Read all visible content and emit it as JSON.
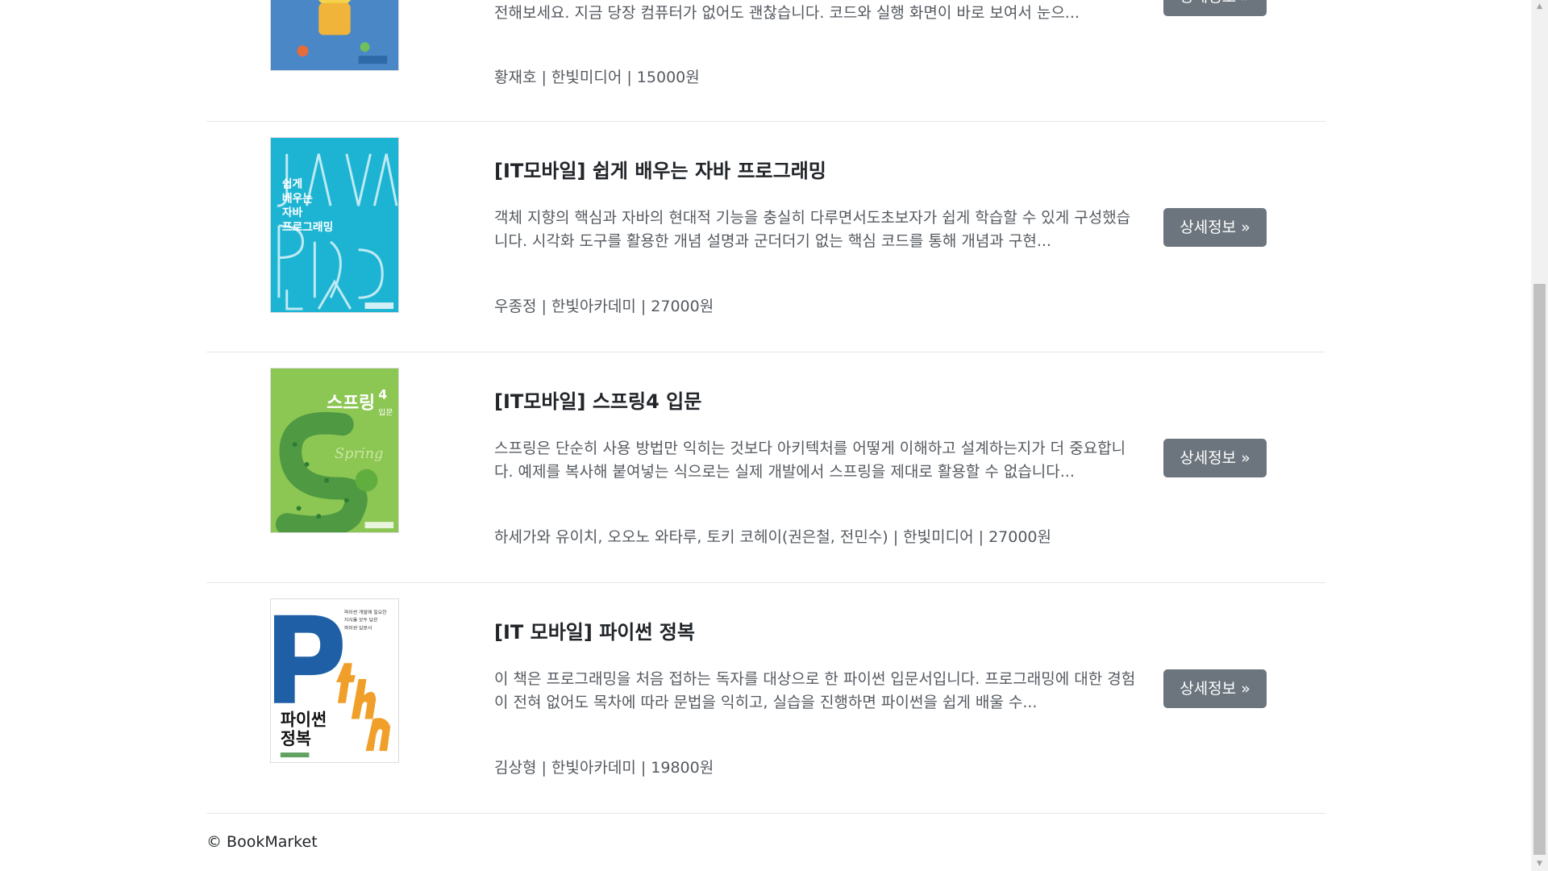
{
  "books": [
    {
      "title": "",
      "description": "전해보세요. 지금 당장 컴퓨터가 없어도 괜찮습니다. 코드와 실행 화면이 바로 보여서 눈으...",
      "meta": "황재호 | 한빛미디어 | 15000원",
      "button_label": "상세정보 »"
    },
    {
      "title": "[IT모바일] 쉽게 배우는 자바 프로그래밍",
      "description": "객체 지향의 핵심과 자바의 현대적 기능을 충실히 다루면서도초보자가 쉽게 학습할 수 있게 구성했습니다. 시각화 도구를 활용한 개념 설명과 군더더기 없는 핵심 코드를 통해 개념과 구현...",
      "meta": "우종정 | 한빛아카데미 | 27000원",
      "button_label": "상세정보 »",
      "cover_text": "쉽게 배우는 자바 프로그래밍"
    },
    {
      "title": "[IT모바일] 스프링4 입문",
      "description": "스프링은 단순히 사용 방법만 익히는 것보다 아키텍처를 어떻게 이해하고 설계하는지가 더 중요합니다. 예제를 복사해 붙여넣는 식으로는 실제 개발에서 스프링을 제대로 활용할 수 없습니다...",
      "meta": "하세가와 유이치, 오오노 와타루, 토키 코헤이(권은철, 전민수) | 한빛미디어 | 27000원",
      "button_label": "상세정보 »",
      "cover_text": "스프링4 입문"
    },
    {
      "title": "[IT 모바일] 파이썬 정복",
      "description": "이 책은 프로그래밍을 처음 접하는 독자를 대상으로 한 파이썬 입문서입니다. 프로그래밍에 대한 경험이 전혀 없어도 목차에 따라 문법을 익히고, 실습을 진행하면 파이썬을 쉽게 배울 수...",
      "meta": "김상형 | 한빛아카데미 | 19800원",
      "button_label": "상세정보 »",
      "cover_text": "파이썬 정복"
    }
  ],
  "footer": {
    "copyright": "© BookMarket"
  },
  "colors": {
    "button_bg": "#6c757d",
    "java_cover": "#1db4d3",
    "spring_cover": "#8cc653",
    "python_blue": "#1f5fa6",
    "python_orange": "#f0a02a"
  }
}
